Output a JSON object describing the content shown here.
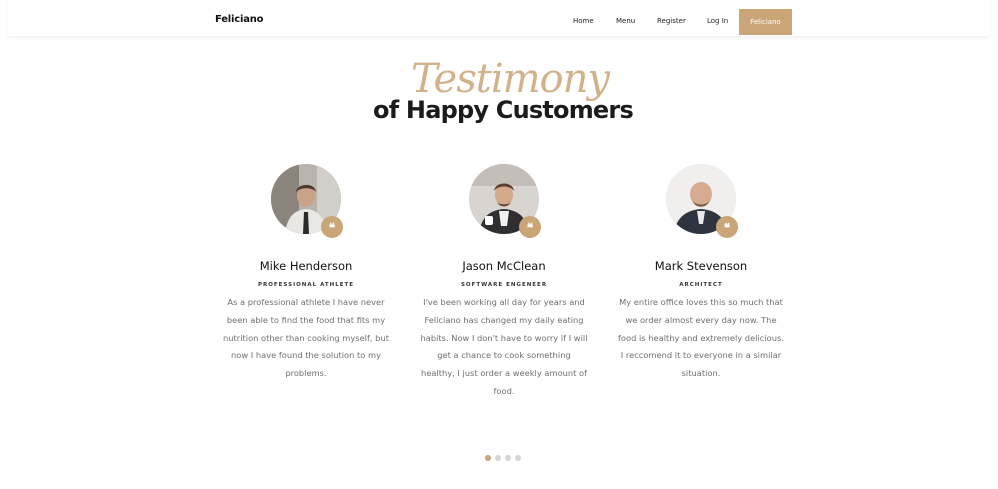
{
  "brand": "Feliciano",
  "nav": {
    "items": [
      "Home",
      "Menu",
      "Register",
      "Log In"
    ],
    "cta": "Feliciano"
  },
  "heading": {
    "script": "Testimony",
    "title": "of Happy Customers"
  },
  "testimonials": [
    {
      "name": "Mike Henderson",
      "role": "PROFESSIONAL ATHLETE",
      "text": "As a professional athlete I have never been able to find the food that fits my nutrition other than cooking myself, but now I have found the solution to my problems."
    },
    {
      "name": "Jason McClean",
      "role": "SOFTWARE ENGENEER",
      "text": "I've been working all day for years and Feliciano has changed my daily eating habits. Now I don't have to worry if I will get a chance to cook something healthy, I just order a weekly amount of food."
    },
    {
      "name": "Mark Stevenson",
      "role": "ARCHITECT",
      "text": "My entire office loves this so much that we order almost every day now. The food is healthy and extremely delicious. I reccomend it to everyone in a similar situation."
    }
  ],
  "quote_glyph": "❝",
  "colors": {
    "accent": "#c9a577"
  },
  "carousel": {
    "pages": 4,
    "active": 1
  }
}
